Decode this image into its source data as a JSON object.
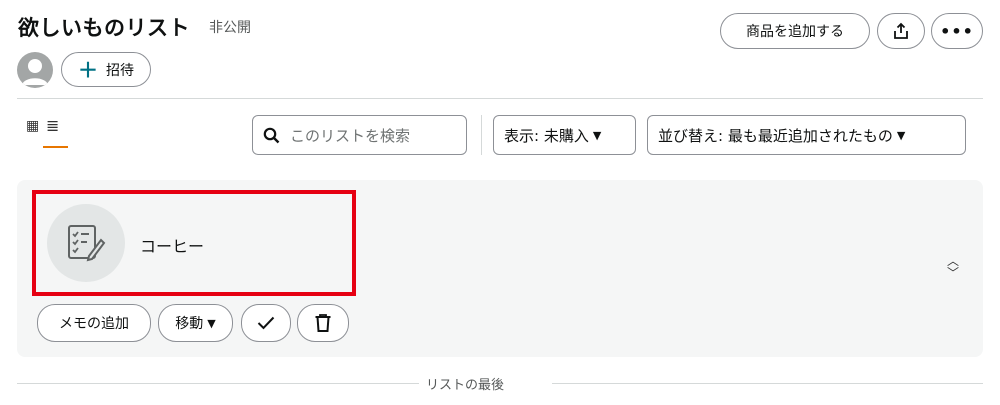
{
  "header": {
    "title": "欲しいものリスト",
    "visibility": "非公開",
    "invite_label": "招待",
    "add_item_label": "商品を追加する",
    "more_label": "•••"
  },
  "toolbar": {
    "search_placeholder": "このリストを検索",
    "show_filter": "表示: 未購入",
    "sort_label": "並び替え: 最も最近追加されたもの"
  },
  "items": [
    {
      "name": "コーヒー",
      "icon": "checklist-pencil-icon",
      "actions": {
        "memo": "メモの追加",
        "move": "移動"
      }
    }
  ],
  "footer": {
    "end_of_list": "リストの最後"
  },
  "colors": {
    "accent_underline": "#e77600",
    "highlight": "#e60012",
    "card_bg": "#f5f6f6",
    "border": "#8d9096",
    "link": "#007185"
  }
}
